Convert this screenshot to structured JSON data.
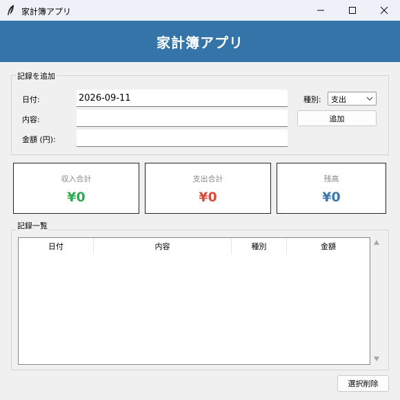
{
  "window": {
    "title": "家計簿アプリ"
  },
  "header": {
    "title": "家計簿アプリ"
  },
  "form": {
    "group_label": "記録を追加",
    "date_label": "日付:",
    "date_value": "2026-09-11",
    "desc_label": "内容:",
    "desc_value": "",
    "amount_label": "金額 (円):",
    "amount_value": "",
    "type_label": "種別:",
    "type_value": "支出",
    "add_button": "追加"
  },
  "summary": {
    "income": {
      "label": "収入合計",
      "value": "¥0",
      "color": "#2eaa52"
    },
    "expense": {
      "label": "支出合計",
      "value": "¥0",
      "color": "#e0493a"
    },
    "balance": {
      "label": "残高",
      "value": "¥0",
      "color": "#3a78ae"
    }
  },
  "records": {
    "group_label": "記録一覧",
    "columns": [
      "日付",
      "内容",
      "種別",
      "金額"
    ],
    "rows": []
  },
  "footer": {
    "delete_button": "選択削除"
  },
  "colors": {
    "banner": "#3574a8",
    "titlebar": "#eef1f8"
  }
}
